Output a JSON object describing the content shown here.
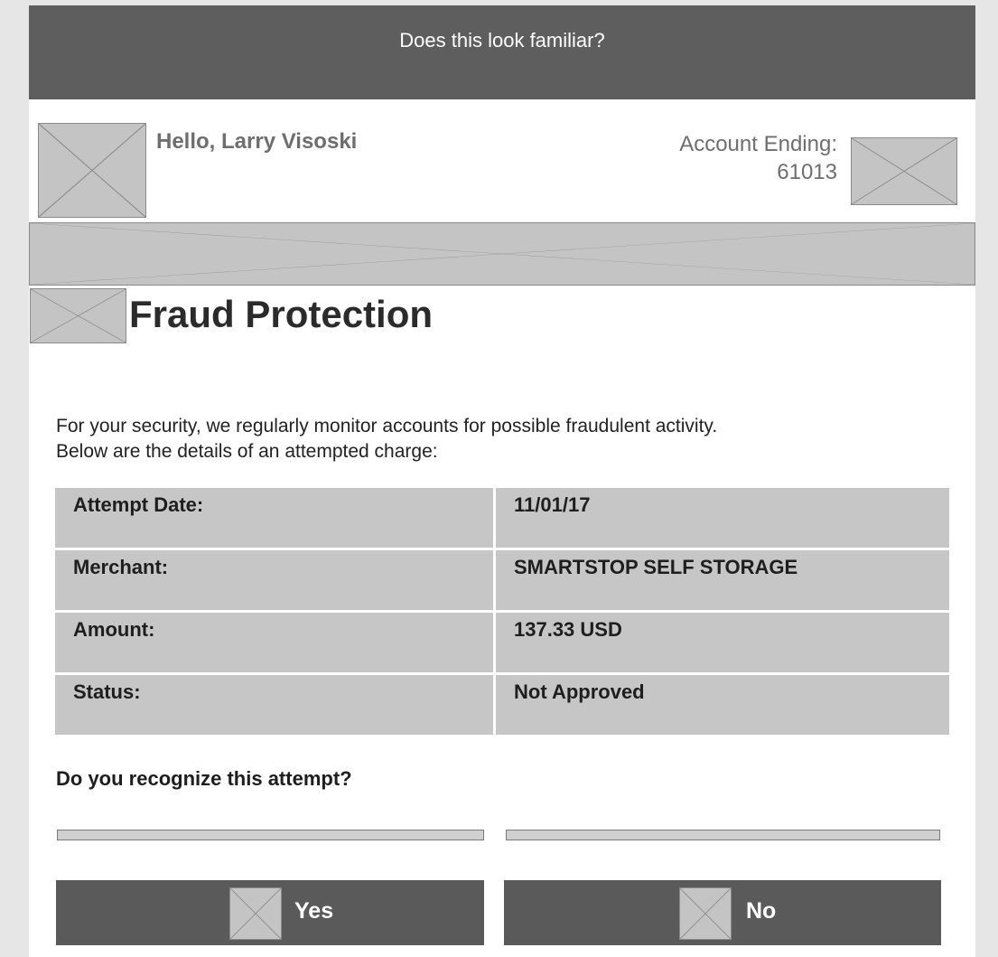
{
  "banner": {
    "text": "Does this look familiar?"
  },
  "header": {
    "greeting": "Hello, Larry Visoski",
    "account_label": "Account Ending:",
    "account_number": "61013"
  },
  "section": {
    "title": "Fraud Protection"
  },
  "intro": {
    "line1": "For your security, we regularly monitor accounts for possible fraudulent activity.",
    "line2": "Below are the details of an attempted charge:"
  },
  "details": [
    {
      "label": "Attempt Date:",
      "value": "11/01/17"
    },
    {
      "label": "Merchant:",
      "value": "SMARTSTOP SELF STORAGE"
    },
    {
      "label": "Amount:",
      "value": "137.33 USD"
    },
    {
      "label": "Status:",
      "value": "Not Approved"
    }
  ],
  "question": "Do you recognize this attempt?",
  "buttons": {
    "yes": "Yes",
    "no": "No"
  },
  "colors": {
    "banner": "#5e5e5e",
    "button": "#5a5a5a",
    "table_cell": "#c6c6c6"
  }
}
